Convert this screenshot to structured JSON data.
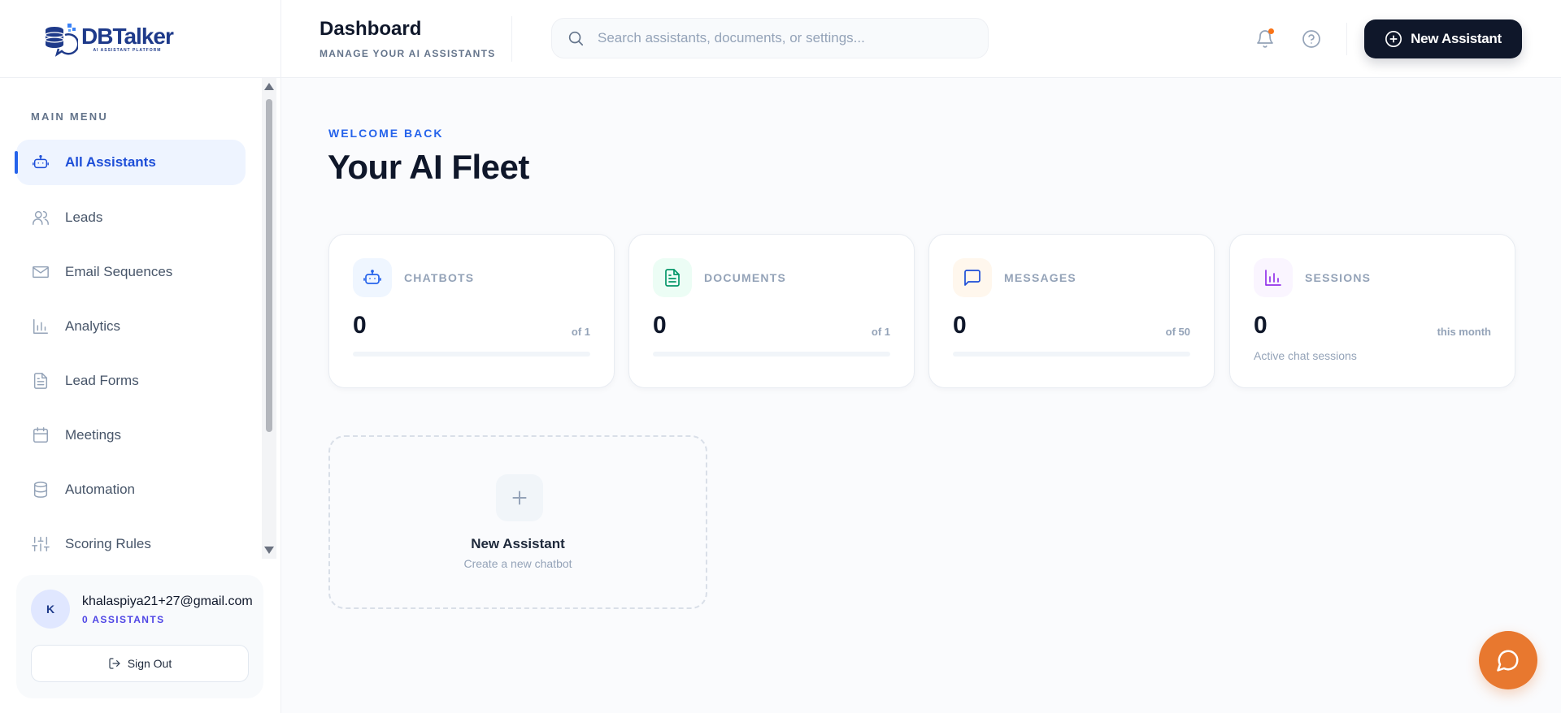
{
  "brand": {
    "logo_text": "DBTalker",
    "logo_sub": "AI ASSISTANT PLATFORM",
    "colors": {
      "primary": "#1e3a8a",
      "accent": "#2563eb",
      "dark": "#0f172a",
      "fab": "#e8782f"
    }
  },
  "sidebar": {
    "section_label": "MAIN MENU",
    "items": [
      {
        "label": "All Assistants",
        "icon": "robot-icon",
        "active": true
      },
      {
        "label": "Leads",
        "icon": "users-icon"
      },
      {
        "label": "Email Sequences",
        "icon": "mail-icon"
      },
      {
        "label": "Analytics",
        "icon": "bar-chart-icon"
      },
      {
        "label": "Lead Forms",
        "icon": "document-icon"
      },
      {
        "label": "Meetings",
        "icon": "calendar-icon"
      },
      {
        "label": "Automation",
        "icon": "database-icon"
      },
      {
        "label": "Scoring Rules",
        "icon": "sliders-icon"
      }
    ],
    "user": {
      "initial": "K",
      "email": "khalaspiya21+27@gmail.com",
      "assistants": "0 ASSISTANTS",
      "sign_out": "Sign Out"
    }
  },
  "header": {
    "title": "Dashboard",
    "subtitle": "MANAGE YOUR AI ASSISTANTS",
    "search_placeholder": "Search assistants, documents, or settings...",
    "new_button": "New Assistant"
  },
  "main": {
    "welcome": "WELCOME BACK",
    "title": "Your AI Fleet",
    "stats": [
      {
        "label": "CHATBOTS",
        "value": "0",
        "max": "of 1",
        "icon": "robot-icon",
        "usage": 0
      },
      {
        "label": "DOCUMENTS",
        "value": "0",
        "max": "of 1",
        "icon": "file-text-icon",
        "usage": 0
      },
      {
        "label": "MESSAGES",
        "value": "0",
        "max": "of 50",
        "icon": "message-square-icon",
        "usage": 0
      },
      {
        "label": "SESSIONS",
        "value": "0",
        "max": "this month",
        "icon": "bar-chart-icon",
        "note": "Active chat sessions"
      }
    ],
    "new_card": {
      "title": "New Assistant",
      "subtitle": "Create a new chatbot"
    }
  },
  "fab": {
    "icon": "chat-bubble-icon"
  }
}
